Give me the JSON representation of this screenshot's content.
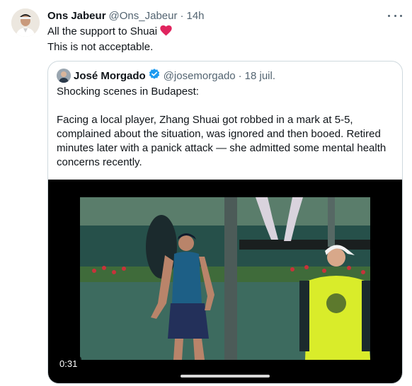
{
  "tweet": {
    "author_name": "Ons Jabeur",
    "author_handle": "@Ons_Jabeur",
    "separator": "·",
    "time": "14h",
    "text_line1": "All the support to Shuai",
    "text_line2": "This is not acceptable.",
    "heart_color": "#e0245e",
    "more_icon": "more-horizontal-icon"
  },
  "quote": {
    "author_name": "José Morgado",
    "author_handle": "@josemorgado",
    "separator": "·",
    "time": "18 juil.",
    "verified_color": "#1d9bf0",
    "paragraph1": "Shocking scenes in Budapest:",
    "paragraph2_lines": [
      "Facing a local player, Zhang Shuai got robbed in a mark at 5-5,",
      "complained about the situation, was ignored and then booed. Retired",
      "minutes later with a panick attack — she admitted some mental health",
      "concerns recently."
    ],
    "video": {
      "duration": "0:31"
    }
  }
}
